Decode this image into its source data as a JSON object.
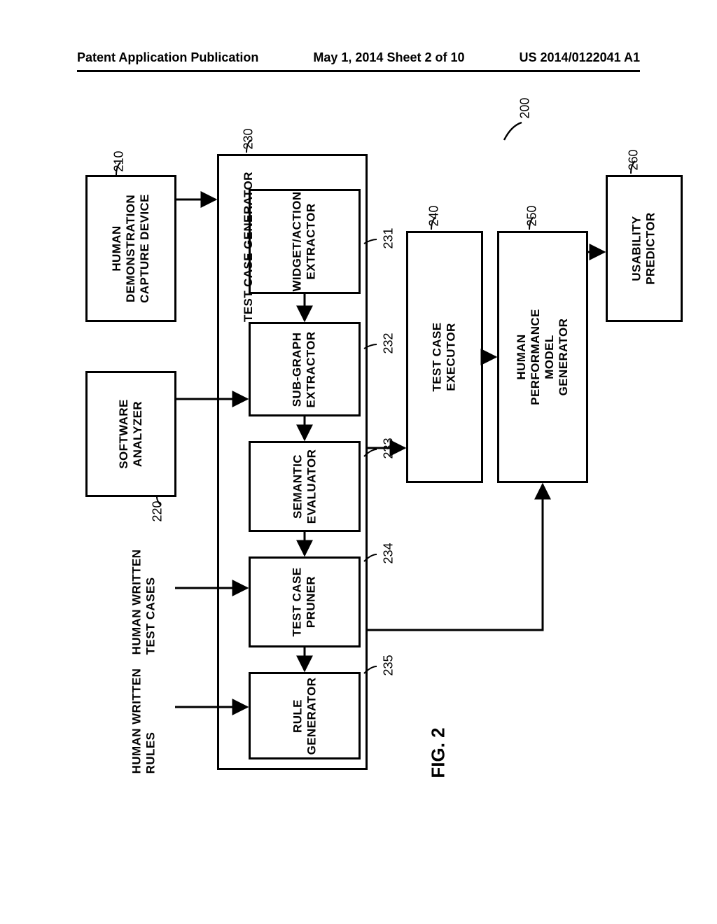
{
  "header": {
    "left": "Patent Application Publication",
    "center": "May 1, 2014  Sheet 2 of 10",
    "right": "US 2014/0122041 A1"
  },
  "figure_label": "FIG. 2",
  "system_ref": "200",
  "blocks": {
    "capture": {
      "ref": "210",
      "text": "HUMAN\nDEMONSTRATION\nCAPTURE DEVICE"
    },
    "analyzer": {
      "ref": "220",
      "text": "SOFTWARE\nANALYZER"
    },
    "tcg_title": {
      "ref": "230",
      "text": "TEST CASE GENERATOR"
    },
    "widget": {
      "ref": "231",
      "text": "WIDGET/ACTION\nEXTRACTOR"
    },
    "subgraph": {
      "ref": "232",
      "text": "SUB-GRAPH\nEXTRACTOR"
    },
    "semantic": {
      "ref": "233",
      "text": "SEMANTIC\nEVALUATOR"
    },
    "pruner": {
      "ref": "234",
      "text": "TEST CASE\nPRUNER"
    },
    "rulegen": {
      "ref": "235",
      "text": "RULE\nGENERATOR"
    },
    "executor": {
      "ref": "240",
      "text": "TEST CASE\nEXECUTOR"
    },
    "hpm": {
      "ref": "250",
      "text": "HUMAN\nPERFORMANCE\nMODEL\nGENERATOR"
    },
    "predictor": {
      "ref": "260",
      "text": "USABILITY\nPREDICTOR"
    }
  },
  "free_text": {
    "hw_cases": "HUMAN WRITTEN\nTEST CASES",
    "hw_rules": "HUMAN WRITTEN\nRULES"
  }
}
